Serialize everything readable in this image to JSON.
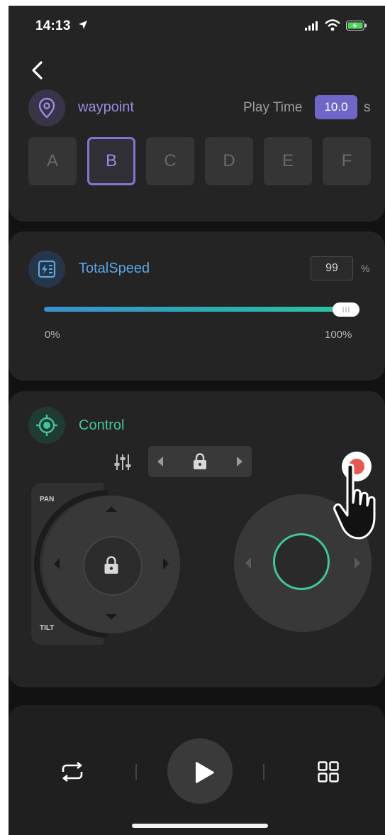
{
  "status_bar": {
    "time": "14:13"
  },
  "waypoint": {
    "title": "waypoint",
    "play_time_label": "Play Time",
    "play_time_value": "10.0",
    "play_time_unit": "s",
    "buttons": [
      "A",
      "B",
      "C",
      "D",
      "E",
      "F"
    ],
    "selected": "B"
  },
  "total_speed": {
    "title": "TotalSpeed",
    "value": "99",
    "unit": "%",
    "slider_min_label": "0%",
    "slider_max_label": "100%",
    "slider_fraction": 0.99
  },
  "control": {
    "title": "Control",
    "pan_label": "PAN",
    "tilt_label": "TILT"
  },
  "colors": {
    "waypoint_accent": "#8077cf",
    "speed_accent": "#5aa7e6",
    "control_accent": "#3fc79a",
    "record_red": "#e8584c"
  }
}
